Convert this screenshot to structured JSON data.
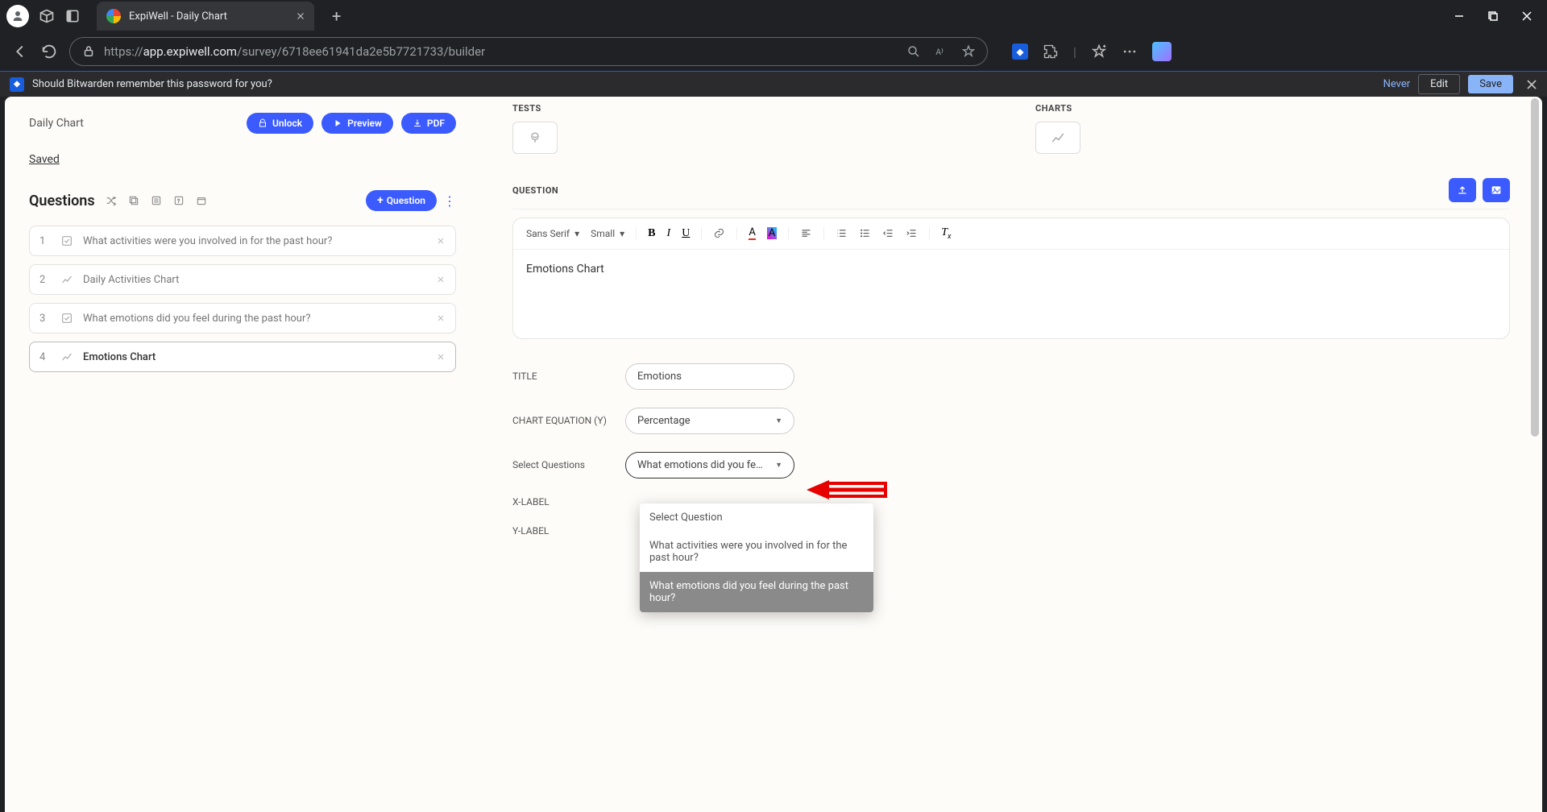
{
  "browser": {
    "tab_title": "ExpiWell - Daily Chart",
    "url_prefix": "https://",
    "url_host": "app.expiwell.com",
    "url_path": "/survey/6718ee61941da2e5b7721733/builder"
  },
  "infobar": {
    "text": "Should Bitwarden remember this password for you?",
    "never": "Never",
    "edit": "Edit",
    "save": "Save"
  },
  "left": {
    "title": "Daily Chart",
    "unlock": "Unlock",
    "preview": "Preview",
    "pdf": "PDF",
    "saved": "Saved",
    "questions_heading": "Questions",
    "add_question": "Question",
    "items": [
      {
        "num": "1",
        "text": "What activities were you involved in for the past hour?",
        "icon": "check"
      },
      {
        "num": "2",
        "text": "Daily Activities Chart",
        "icon": "chart"
      },
      {
        "num": "3",
        "text": "What emotions did you feel during the past hour?",
        "icon": "check"
      },
      {
        "num": "4",
        "text": "Emotions Chart",
        "icon": "chart"
      }
    ]
  },
  "right": {
    "tests_label": "TESTS",
    "charts_label": "CHARTS",
    "question_label": "QUESTION",
    "font_family": "Sans Serif",
    "font_size": "Small",
    "editor_text": "Emotions Chart",
    "form": {
      "title_label": "TITLE",
      "title_value": "Emotions",
      "eq_label": "CHART EQUATION (Y)",
      "eq_value": "Percentage",
      "sq_label": "Select Questions",
      "sq_value": "What emotions did you feel during ...",
      "xlabel": "X-LABEL",
      "ylabel": "Y-LABEL"
    },
    "dropdown": {
      "opt0": "Select Question",
      "opt1": "What activities were you involved in for the past hour?",
      "opt2": "What emotions did you feel during the past hour?"
    }
  }
}
